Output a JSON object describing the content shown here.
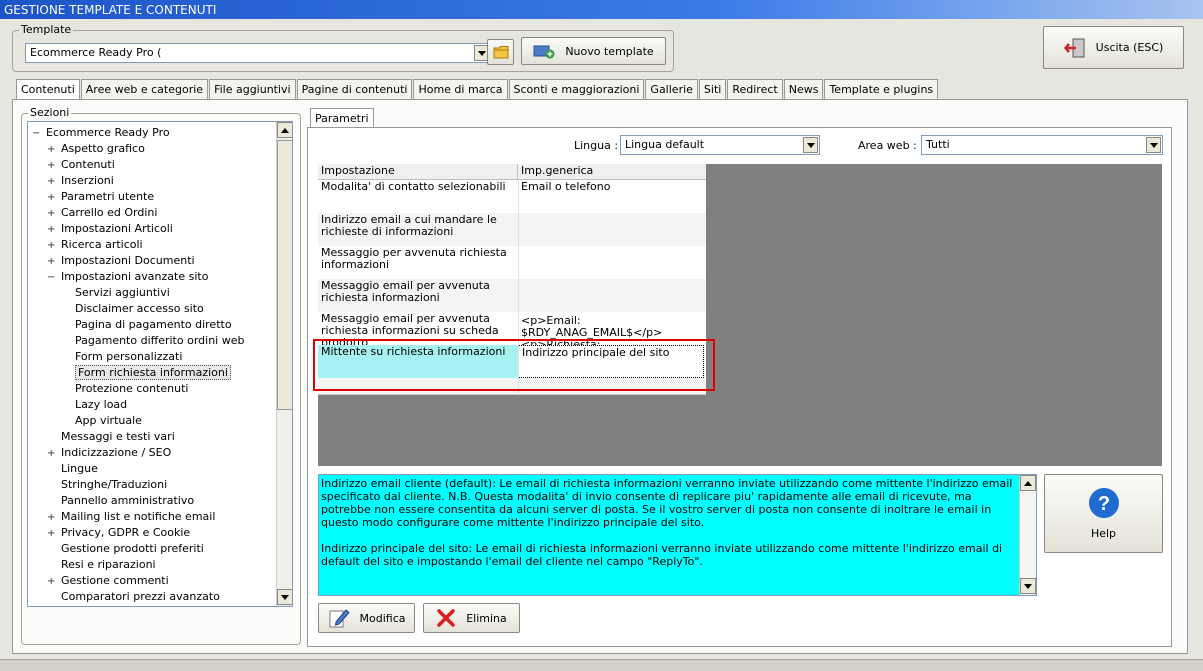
{
  "window": {
    "title": "GESTIONE TEMPLATE E CONTENUTI"
  },
  "template_group": {
    "label": "Template",
    "selected": "Ecommerce Ready Pro (",
    "new_template_label": "Nuovo template"
  },
  "exit_button": {
    "label": "Uscita (ESC)"
  },
  "tabs": [
    {
      "label": "Contenuti",
      "active": true
    },
    {
      "label": "Aree web e categorie"
    },
    {
      "label": "File aggiuntivi"
    },
    {
      "label": "Pagine di contenuti"
    },
    {
      "label": "Home di marca"
    },
    {
      "label": "Sconti e maggiorazioni"
    },
    {
      "label": "Gallerie"
    },
    {
      "label": "Siti"
    },
    {
      "label": "Redirect"
    },
    {
      "label": "News"
    },
    {
      "label": "Template e plugins"
    }
  ],
  "sections": {
    "label": "Sezioni",
    "tree": [
      {
        "label": "Ecommerce Ready Pro",
        "level": 0,
        "expander": "−"
      },
      {
        "label": "Aspetto grafico",
        "level": 1,
        "expander": "+"
      },
      {
        "label": "Contenuti",
        "level": 1,
        "expander": "+"
      },
      {
        "label": "Inserzioni",
        "level": 1,
        "expander": "+"
      },
      {
        "label": "Parametri utente",
        "level": 1,
        "expander": "+"
      },
      {
        "label": "Carrello ed Ordini",
        "level": 1,
        "expander": "+"
      },
      {
        "label": "Impostazioni Articoli",
        "level": 1,
        "expander": "+"
      },
      {
        "label": "Ricerca articoli",
        "level": 1,
        "expander": "+"
      },
      {
        "label": "Impostazioni Documenti",
        "level": 1,
        "expander": "+"
      },
      {
        "label": "Impostazioni avanzate sito",
        "level": 1,
        "expander": "−"
      },
      {
        "label": "Servizi aggiuntivi",
        "level": 2
      },
      {
        "label": "Disclaimer accesso sito",
        "level": 2
      },
      {
        "label": "Pagina di pagamento diretto",
        "level": 2
      },
      {
        "label": "Pagamento differito ordini web",
        "level": 2
      },
      {
        "label": "Form personalizzati",
        "level": 2
      },
      {
        "label": "Form richiesta informazioni",
        "level": 2,
        "selected": true
      },
      {
        "label": "Protezione contenuti",
        "level": 2
      },
      {
        "label": "Lazy load",
        "level": 2
      },
      {
        "label": "App virtuale",
        "level": 2
      },
      {
        "label": "Messaggi e testi vari",
        "level": 1
      },
      {
        "label": "Indicizzazione / SEO",
        "level": 1,
        "expander": "+"
      },
      {
        "label": "Lingue",
        "level": 1
      },
      {
        "label": "Stringhe/Traduzioni",
        "level": 1
      },
      {
        "label": "Pannello amministrativo",
        "level": 1
      },
      {
        "label": "Mailing list e notifiche email",
        "level": 1,
        "expander": "+"
      },
      {
        "label": "Privacy, GDPR e Cookie",
        "level": 1,
        "expander": "+"
      },
      {
        "label": "Gestione prodotti preferiti",
        "level": 1
      },
      {
        "label": "Resi e riparazioni",
        "level": 1
      },
      {
        "label": "Gestione commenti",
        "level": 1,
        "expander": "+"
      },
      {
        "label": "Comparatori prezzi avanzato",
        "level": 1
      }
    ]
  },
  "params_tab": {
    "label": "Parametri"
  },
  "filters": {
    "lingua_label": "Lingua :",
    "lingua_value": "Lingua default",
    "area_label": "Area web :",
    "area_value": "Tutti"
  },
  "grid": {
    "headers": [
      "Impostazione",
      "Imp.generica"
    ],
    "rows": [
      {
        "setting": "Modalita' di contatto selezionabili",
        "value": "Email o telefono"
      },
      {
        "setting": "Indirizzo email a cui mandare le richieste di informazioni",
        "value": ""
      },
      {
        "setting": "Messaggio per avvenuta richiesta informazioni",
        "value": ""
      },
      {
        "setting": "Messaggio email per avvenuta richiesta informazioni",
        "value": ""
      },
      {
        "setting": "Messaggio email per avvenuta richiesta informazioni su scheda prodotto",
        "value": "<p>Email: $RDY_ANAG_EMAIL$</p> <p>Richiesta:"
      },
      {
        "setting": "Mittente su richiesta informazioni",
        "value": "Indirizzo principale del sito",
        "selected": true
      }
    ]
  },
  "description": {
    "p1": "Indirizzo email cliente (default): Le email di richiesta informazioni verranno inviate utilizzando come mittente l'indirizzo email specificato dal cliente. N.B. Questa modalita' di invio consente di replicare piu' rapidamente alle email di ricevute, ma potrebbe non essere consentita da alcuni server di posta. Se il vostro server di posta non consente di inoltrare le email in questo modo configurare come mittente l'indirizzo principale del sito.",
    "p2": "Indirizzo principale del sito: Le email di richiesta informazioni verranno inviate utilizzando come mittente l'indirizzo email di default del sito e impostando l'email del cliente nel campo \"ReplyTo\"."
  },
  "buttons": {
    "help": "Help",
    "modifica": "Modifica",
    "elimina": "Elimina"
  },
  "colors": {
    "description_bg": "#00ffff",
    "selected_row_bg": "#a6f2f2",
    "highlight_border": "#e00000",
    "title_bar": "#1c55c8"
  }
}
